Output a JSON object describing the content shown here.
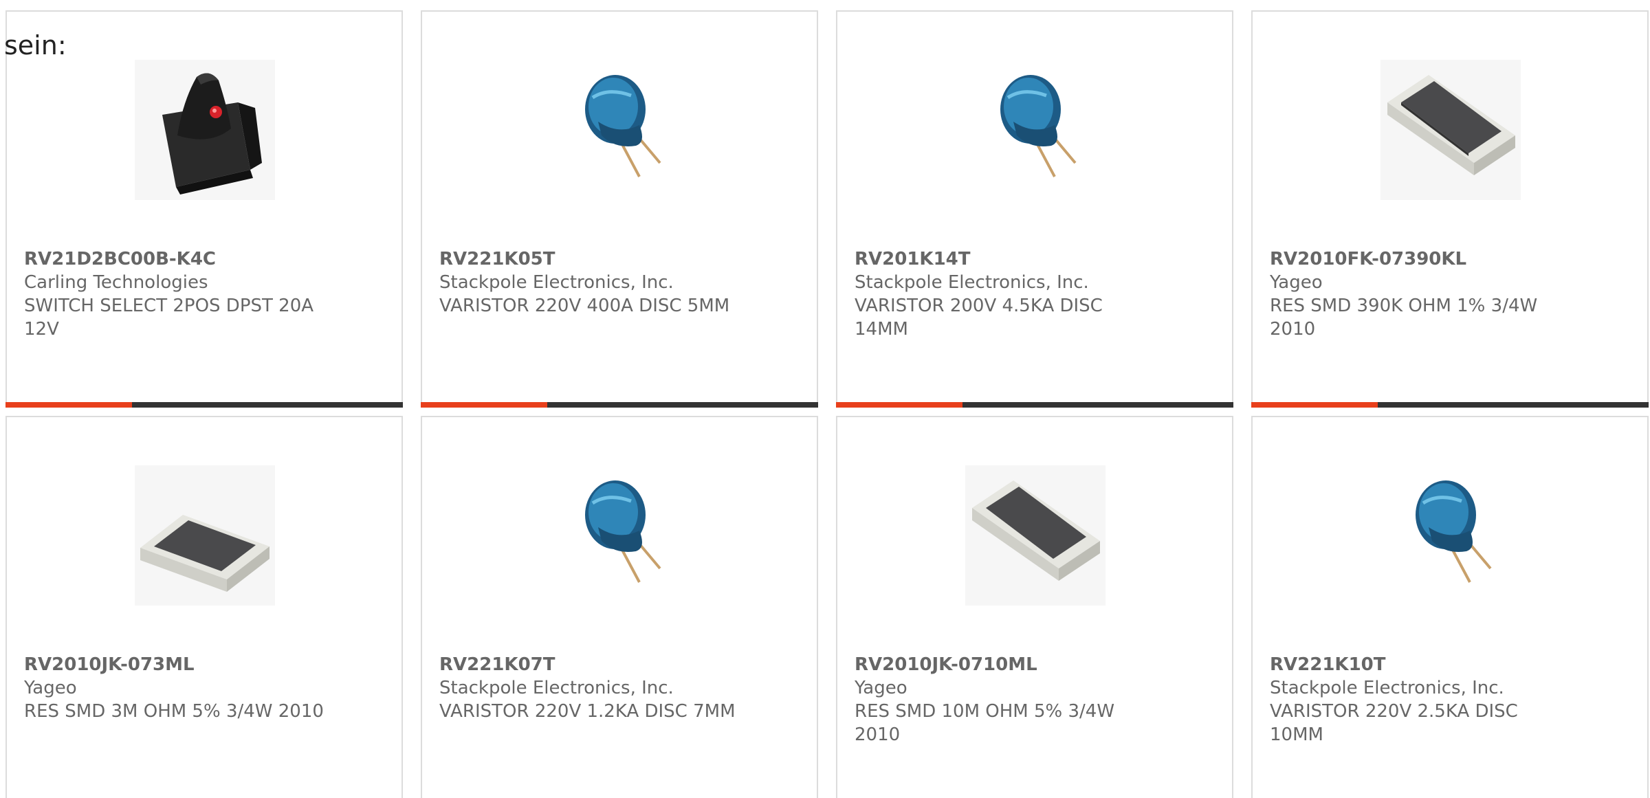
{
  "intro": {
    "text": "sein:"
  },
  "colors": {
    "accent": "#e8401c",
    "bar": "#333333",
    "text": "#666666",
    "border": "#dcdcdc"
  },
  "products": [
    {
      "part": "RV21D2BC00B-K4C",
      "maker": "Carling Technologies",
      "desc": "SWITCH SELECT 2POS DPST 20A 12V",
      "image": "rocker-switch"
    },
    {
      "part": "RV221K05T",
      "maker": "Stackpole Electronics, Inc.",
      "desc": "VARISTOR 220V 400A DISC 5MM",
      "image": "disc-varistor"
    },
    {
      "part": "RV201K14T",
      "maker": "Stackpole Electronics, Inc.",
      "desc": "VARISTOR 200V 4.5KA DISC 14MM",
      "image": "disc-varistor"
    },
    {
      "part": "RV2010FK-07390KL",
      "maker": "Yageo",
      "desc": "RES SMD 390K OHM 1% 3/4W 2010",
      "image": "smd-resistor"
    },
    {
      "part": "RV2010JK-073ML",
      "maker": "Yageo",
      "desc": "RES SMD 3M OHM 5% 3/4W 2010",
      "image": "smd-resistor"
    },
    {
      "part": "RV221K07T",
      "maker": "Stackpole Electronics, Inc.",
      "desc": "VARISTOR 220V 1.2KA DISC 7MM",
      "image": "disc-varistor"
    },
    {
      "part": "RV2010JK-0710ML",
      "maker": "Yageo",
      "desc": "RES SMD 10M OHM 5% 3/4W 2010",
      "image": "smd-resistor"
    },
    {
      "part": "RV221K10T",
      "maker": "Stackpole Electronics, Inc.",
      "desc": "VARISTOR 220V 2.5KA DISC 10MM",
      "image": "disc-varistor"
    }
  ]
}
